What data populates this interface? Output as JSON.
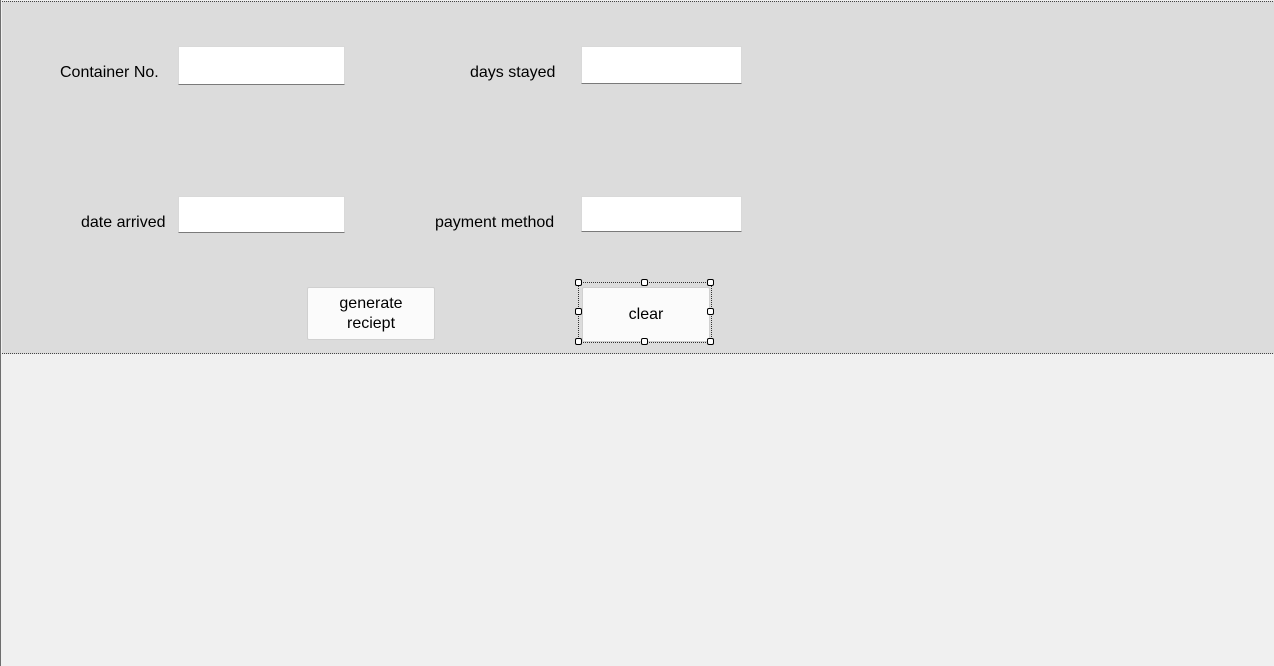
{
  "form": {
    "container_no": {
      "label": "Container No.",
      "value": ""
    },
    "date_arrived": {
      "label": "date arrived",
      "value": ""
    },
    "days_stayed": {
      "label": "days stayed",
      "value": ""
    },
    "payment_method": {
      "label": "payment method",
      "value": ""
    }
  },
  "buttons": {
    "generate_line1": "generate",
    "generate_line2": "reciept",
    "clear": "clear"
  },
  "designer": {
    "selected_control": "clear"
  }
}
